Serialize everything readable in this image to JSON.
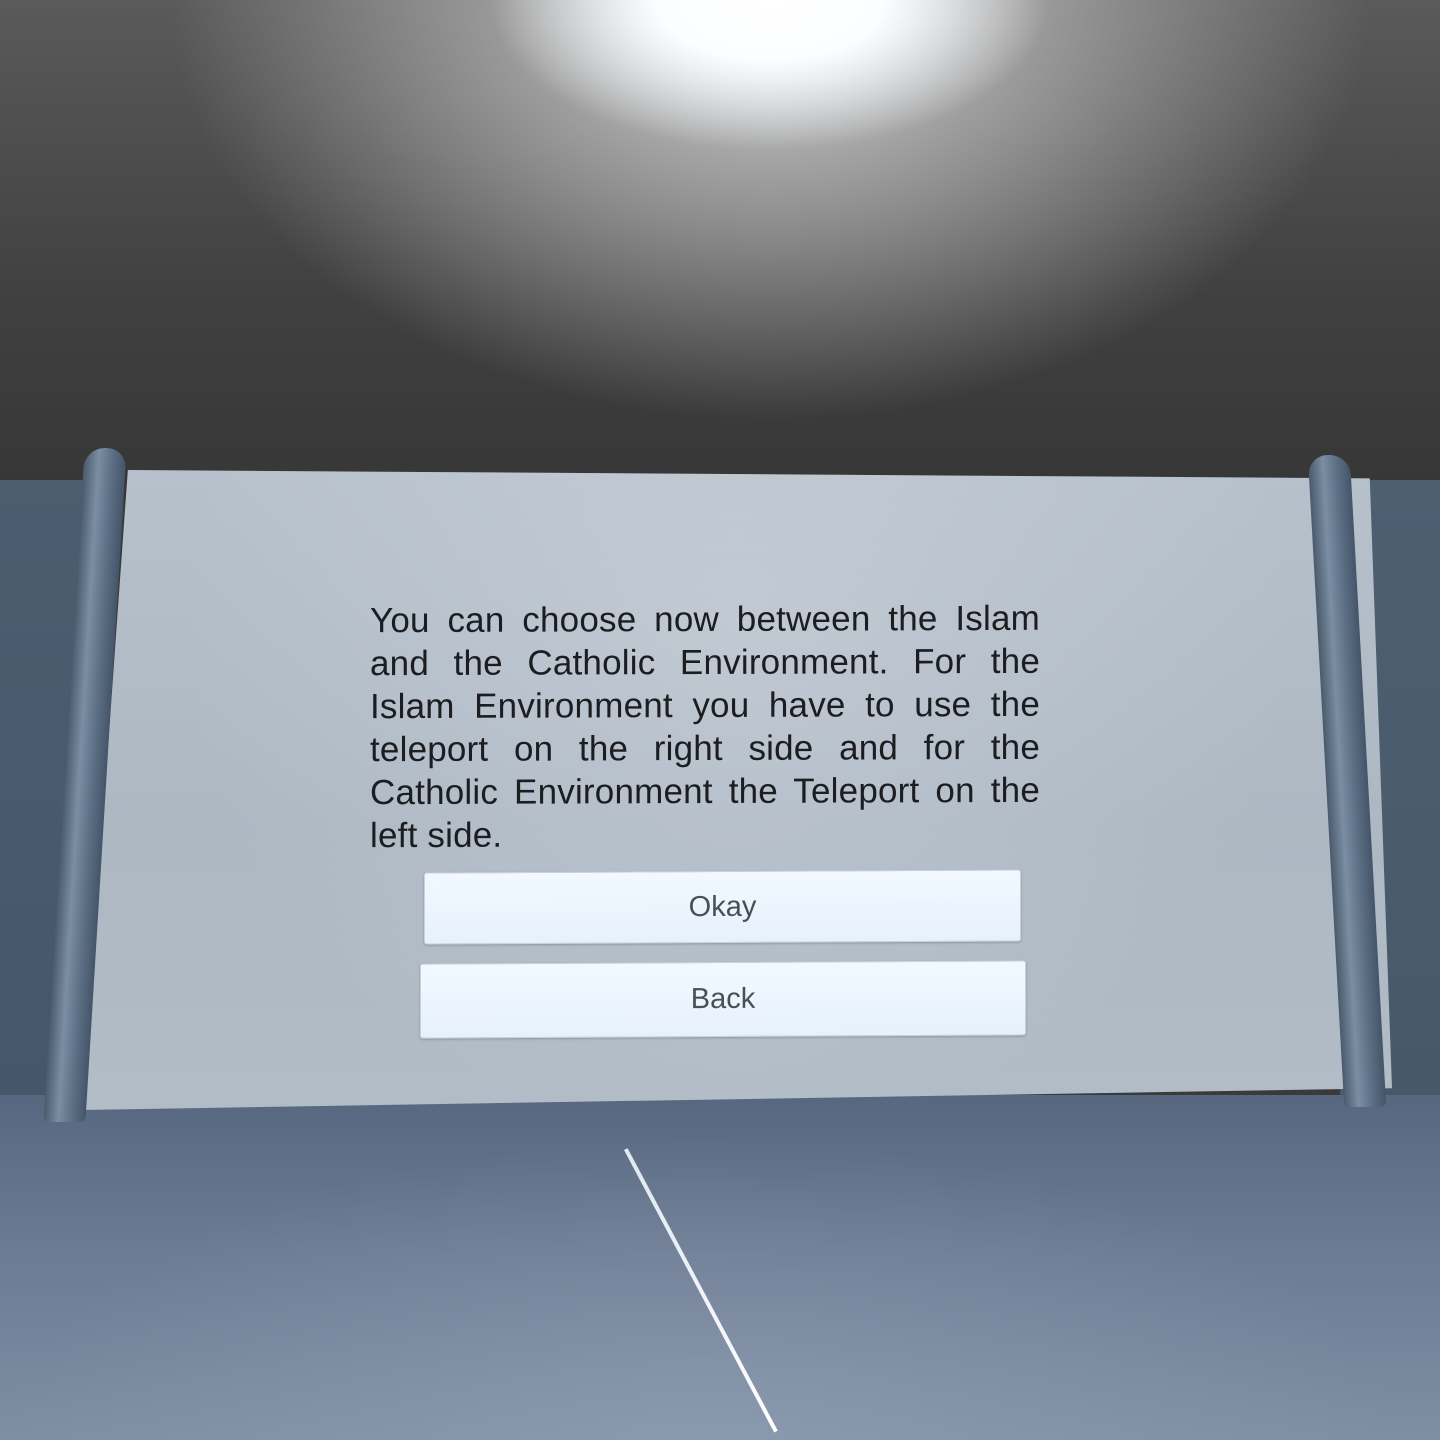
{
  "dialog": {
    "message": "You can choose now between the Islam and the Catholic Environment. For the Islam Environment you have to use the teleport on the right side and for the Catholic Environment the Teleport on the left side.",
    "okay_label": "Okay",
    "back_label": "Back"
  },
  "colors": {
    "ceiling": "#404040",
    "board": "#b0bbc6",
    "pole": "#6a7c91",
    "floor": "#6c7b92",
    "button": "#e9f3fc",
    "button_text": "#4a4e55",
    "message_text": "#1b1d20",
    "pointer_ray": "#ffffff"
  }
}
